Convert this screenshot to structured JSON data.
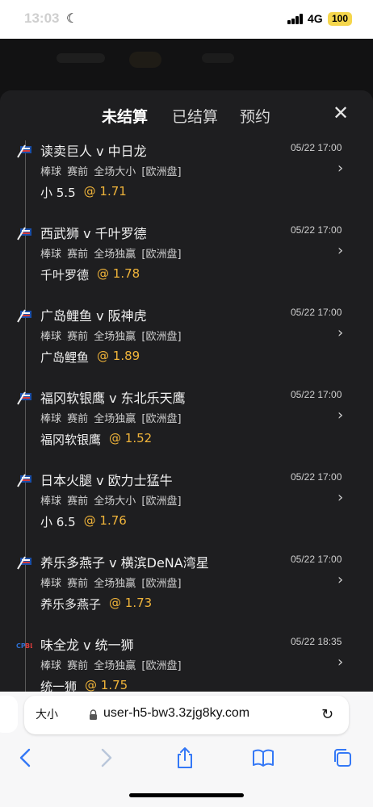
{
  "status": {
    "time": "13:03",
    "network": "4G",
    "battery": "100"
  },
  "tabs": [
    "未结算",
    "已结算",
    "预约"
  ],
  "active_tab": 0,
  "odds_prefix": "@",
  "bets": [
    {
      "match": "读卖巨人 v 中日龙",
      "time": "05/22 17:00",
      "meta": "棒球 赛前 全场大小 [欧洲盘]",
      "pick": "小 5.5",
      "odds": "1.71",
      "badge": "npb"
    },
    {
      "match": "西武狮 v 千叶罗德",
      "time": "05/22 17:00",
      "meta": "棒球 赛前 全场独赢 [欧洲盘]",
      "pick": "千叶罗德",
      "odds": "1.78",
      "badge": "npb"
    },
    {
      "match": "广岛鲤鱼 v 阪神虎",
      "time": "05/22 17:00",
      "meta": "棒球 赛前 全场独赢 [欧洲盘]",
      "pick": "广岛鲤鱼",
      "odds": "1.89",
      "badge": "npb"
    },
    {
      "match": "福冈软银鹰 v 东北乐天鹰",
      "time": "05/22 17:00",
      "meta": "棒球 赛前 全场独赢 [欧洲盘]",
      "pick": "福冈软银鹰",
      "odds": "1.52",
      "badge": "npb"
    },
    {
      "match": "日本火腿 v 欧力士猛牛",
      "time": "05/22 17:00",
      "meta": "棒球 赛前 全场大小 [欧洲盘]",
      "pick": "小 6.5",
      "odds": "1.76",
      "badge": "npb"
    },
    {
      "match": "养乐多燕子 v 横滨DeNA湾星",
      "time": "05/22 17:00",
      "meta": "棒球 赛前 全场独赢 [欧洲盘]",
      "pick": "养乐多燕子",
      "odds": "1.73",
      "badge": "npb"
    },
    {
      "match": "味全龙 v 统一狮",
      "time": "05/22 18:35",
      "meta": "棒球 赛前 全场独赢 [欧洲盘]",
      "pick": "统一狮",
      "odds": "1.75",
      "badge": "cpbl"
    }
  ],
  "browser": {
    "text_size_label": "大小",
    "url": "user-h5-bw3.3zjg8ky.com"
  },
  "colors": {
    "accent": "#f0b43a",
    "sheet_bg": "#1e1e20",
    "ios_blue": "#3478f6"
  }
}
